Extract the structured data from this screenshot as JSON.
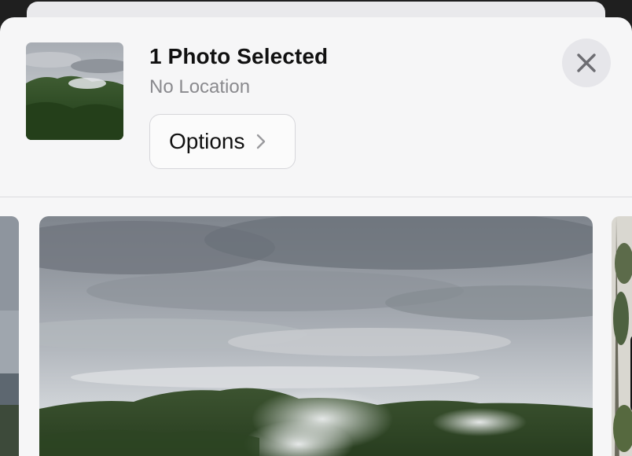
{
  "sheet": {
    "title": "1 Photo Selected",
    "subtitle": "No Location",
    "options_label": "Options"
  },
  "icons": {
    "close": "close-icon",
    "chevron": "chevron-right-icon"
  },
  "colors": {
    "sheet_background": "#f6f6f7",
    "title_text": "#111111",
    "secondary_text": "#8a8a8e",
    "close_button_bg": "#e6e6ea",
    "divider": "#dcdcdf"
  }
}
